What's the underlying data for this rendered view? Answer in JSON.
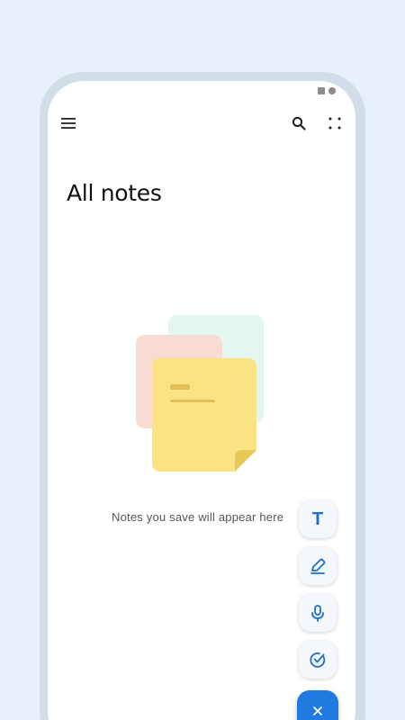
{
  "app": {
    "title": "All notes",
    "empty_state_message": "Notes you save will appear here"
  },
  "toolbar": {
    "menu_icon": "hamburger-menu-icon",
    "search_icon": "search-icon",
    "more_icon": "grid-dots-icon"
  },
  "fab_menu": {
    "items": [
      {
        "icon": "text-note-icon",
        "glyph": "T"
      },
      {
        "icon": "pen-drawing-icon"
      },
      {
        "icon": "microphone-icon"
      },
      {
        "icon": "checklist-icon"
      }
    ],
    "close_icon": "close-icon"
  },
  "colors": {
    "accent": "#1f7be0",
    "icon_blue": "#1b6fc7",
    "sticky_yellow": "#fbe282",
    "sticky_pink": "#f8dcd3",
    "sticky_mint": "#e3f6ef",
    "frame": "#d2ddea",
    "background": "#e7f0fb"
  }
}
